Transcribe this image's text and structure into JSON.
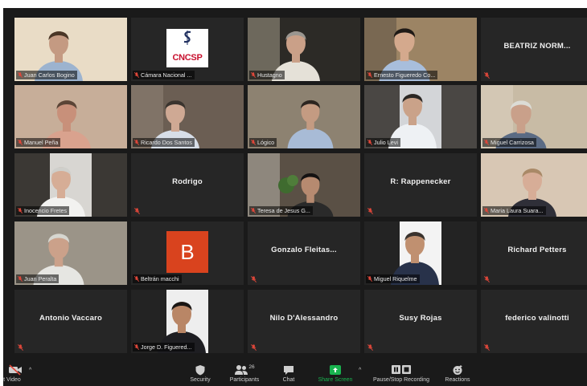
{
  "meeting": {
    "participants": [
      {
        "name": "Juan Carlos Bogino",
        "type": "video"
      },
      {
        "name": "Cámara Nacional ...",
        "type": "logo",
        "logo_text": "CNCSP"
      },
      {
        "name": "Hustagno",
        "type": "video"
      },
      {
        "name": "Ernesto Figueredo Co...",
        "type": "video",
        "active": true
      },
      {
        "name": "BEATRIZ NORM...",
        "type": "namecard"
      },
      {
        "name": "Manuel Peña",
        "type": "video"
      },
      {
        "name": "Ricardo Dos Santos",
        "type": "video"
      },
      {
        "name": "Lógico",
        "type": "video"
      },
      {
        "name": "Julio Levi",
        "type": "video"
      },
      {
        "name": "Miguel Carrizosa",
        "type": "video"
      },
      {
        "name": "Inocencio Fretes",
        "type": "video"
      },
      {
        "name": "Rodrigo",
        "type": "namecard"
      },
      {
        "name": "Teresa de Jesus G...",
        "type": "video"
      },
      {
        "name": "R: Rappenecker",
        "type": "namecard"
      },
      {
        "name": "Maria Laura Suara...",
        "type": "video"
      },
      {
        "name": "Juan Peralta",
        "type": "video"
      },
      {
        "name": "Beltrán macchi",
        "type": "avatar",
        "initial": "B"
      },
      {
        "name": "Gonzalo  Fleitas...",
        "type": "namecard"
      },
      {
        "name": "Miguel Riquelme",
        "type": "video"
      },
      {
        "name": "Richard Petters",
        "type": "namecard"
      },
      {
        "name": "Antonio Vaccaro",
        "type": "namecard"
      },
      {
        "name": "Jorge D. Figuered...",
        "type": "video"
      },
      {
        "name": "Nilo D'Alessandro",
        "type": "namecard"
      },
      {
        "name": "Susy Rojas",
        "type": "namecard"
      },
      {
        "name": "federico valinotti",
        "type": "namecard"
      }
    ]
  },
  "toolbar": {
    "video_label": "t Video",
    "security_label": "Security",
    "participants_label": "Participants",
    "participants_count": "26",
    "chat_label": "Chat",
    "share_label": "Share Screen",
    "record_label": "Pause/Stop Recording",
    "reactions_label": "Reactions"
  },
  "colors": {
    "active_speaker": "#c8ff3a",
    "mic_muted": "#e0473a",
    "share_green": "#19b34f",
    "avatar_b": "#d9431e"
  }
}
